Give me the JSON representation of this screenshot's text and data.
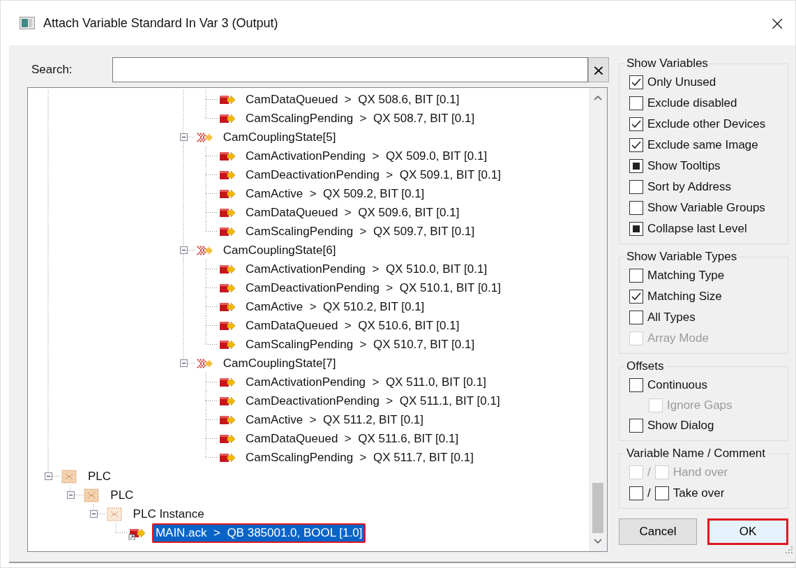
{
  "window": {
    "title": "Attach Variable Standard In Var 3 (Output)",
    "close": "×"
  },
  "search": {
    "label": "Search:",
    "clear": "×"
  },
  "tree": [
    {
      "kind": "offscreen",
      "children": [
        {
          "kind": "offscreen",
          "children": [
            {
              "kind": "offscreen",
              "children": [
                {
                  "kind": "offscreen",
                  "children": [
                    {
                      "kind": "offscreen",
                      "children": [
                        {
                          "kind": "offscreen",
                          "children": [
                            {
                              "kind": "offscreen",
                              "children": [
                                {
                                  "kind": "output",
                                  "label": "CamDataQueued  >  QX 508.6, BIT [0.1]",
                                  "selected": false,
                                  "outlined": false
                                },
                                {
                                  "kind": "output",
                                  "label": "CamScalingPending  >  QX 508.7, BIT [0.1]",
                                  "selected": false,
                                  "outlined": false
                                }
                              ]
                            },
                            {
                              "kind": "struct",
                              "label": "CamCouplingState[5]",
                              "expanded": true,
                              "children": [
                                {
                                  "kind": "output",
                                  "label": "CamActivationPending  >  QX 509.0, BIT [0.1]",
                                  "selected": false,
                                  "outlined": false
                                },
                                {
                                  "kind": "output",
                                  "label": "CamDeactivationPending  >  QX 509.1, BIT [0.1]",
                                  "selected": false,
                                  "outlined": false
                                },
                                {
                                  "kind": "output",
                                  "label": "CamActive  >  QX 509.2, BIT [0.1]",
                                  "selected": false,
                                  "outlined": false
                                },
                                {
                                  "kind": "output",
                                  "label": "CamDataQueued  >  QX 509.6, BIT [0.1]",
                                  "selected": false,
                                  "outlined": false
                                },
                                {
                                  "kind": "output",
                                  "label": "CamScalingPending  >  QX 509.7, BIT [0.1]",
                                  "selected": false,
                                  "outlined": false
                                }
                              ]
                            },
                            {
                              "kind": "struct",
                              "label": "CamCouplingState[6]",
                              "expanded": true,
                              "children": [
                                {
                                  "kind": "output",
                                  "label": "CamActivationPending  >  QX 510.0, BIT [0.1]",
                                  "selected": false,
                                  "outlined": false
                                },
                                {
                                  "kind": "output",
                                  "label": "CamDeactivationPending  >  QX 510.1, BIT [0.1]",
                                  "selected": false,
                                  "outlined": false
                                },
                                {
                                  "kind": "output",
                                  "label": "CamActive  >  QX 510.2, BIT [0.1]",
                                  "selected": false,
                                  "outlined": false
                                },
                                {
                                  "kind": "output",
                                  "label": "CamDataQueued  >  QX 510.6, BIT [0.1]",
                                  "selected": false,
                                  "outlined": false
                                },
                                {
                                  "kind": "output",
                                  "label": "CamScalingPending  >  QX 510.7, BIT [0.1]",
                                  "selected": false,
                                  "outlined": false
                                }
                              ]
                            },
                            {
                              "kind": "struct",
                              "label": "CamCouplingState[7]",
                              "expanded": true,
                              "children": [
                                {
                                  "kind": "output",
                                  "label": "CamActivationPending  >  QX 511.0, BIT [0.1]",
                                  "selected": false,
                                  "outlined": false
                                },
                                {
                                  "kind": "output",
                                  "label": "CamDeactivationPending  >  QX 511.1, BIT [0.1]",
                                  "selected": false,
                                  "outlined": false
                                },
                                {
                                  "kind": "output",
                                  "label": "CamActive  >  QX 511.2, BIT [0.1]",
                                  "selected": false,
                                  "outlined": false
                                },
                                {
                                  "kind": "output",
                                  "label": "CamDataQueued  >  QX 511.6, BIT [0.1]",
                                  "selected": false,
                                  "outlined": false
                                },
                                {
                                  "kind": "output",
                                  "label": "CamScalingPending  >  QX 511.7, BIT [0.1]",
                                  "selected": false,
                                  "outlined": false
                                }
                              ]
                            }
                          ]
                        }
                      ]
                    }
                  ]
                }
              ]
            }
          ]
        }
      ]
    },
    {
      "kind": "plc",
      "label": "PLC",
      "expanded": true,
      "children": [
        {
          "kind": "plc",
          "label": "PLC",
          "expanded": true,
          "children": [
            {
              "kind": "instance",
              "label": "PLC Instance",
              "expanded": true,
              "children": [
                {
                  "kind": "linked-output",
                  "label": "MAIN.ack  >  QB 385001.0, BOOL [1.0]",
                  "selected": true,
                  "outlined": true
                }
              ]
            }
          ]
        }
      ]
    }
  ],
  "groups": [
    {
      "title": "Show Variables",
      "options": [
        {
          "kind": "check",
          "label": "Only Unused",
          "checked": true,
          "indeterminate": false,
          "disabled": false
        },
        {
          "kind": "check",
          "label": "Exclude disabled",
          "checked": false,
          "indeterminate": false,
          "disabled": false
        },
        {
          "kind": "check",
          "label": "Exclude other Devices",
          "checked": true,
          "indeterminate": false,
          "disabled": false
        },
        {
          "kind": "check",
          "label": "Exclude same Image",
          "checked": true,
          "indeterminate": false,
          "disabled": false
        },
        {
          "kind": "check",
          "label": "Show Tooltips",
          "checked": false,
          "indeterminate": true,
          "disabled": false
        },
        {
          "kind": "check",
          "label": "Sort by Address",
          "checked": false,
          "indeterminate": false,
          "disabled": false
        },
        {
          "kind": "check",
          "label": "Show Variable Groups",
          "checked": false,
          "indeterminate": false,
          "disabled": false
        },
        {
          "kind": "check",
          "label": "Collapse last Level",
          "checked": false,
          "indeterminate": true,
          "disabled": false
        }
      ]
    },
    {
      "title": "Show Variable Types",
      "options": [
        {
          "kind": "check",
          "label": "Matching Type",
          "checked": false,
          "indeterminate": false,
          "disabled": false
        },
        {
          "kind": "check",
          "label": "Matching Size",
          "checked": true,
          "indeterminate": false,
          "disabled": false
        },
        {
          "kind": "check",
          "label": "All Types",
          "checked": false,
          "indeterminate": false,
          "disabled": false
        },
        {
          "kind": "check",
          "label": "Array Mode",
          "checked": false,
          "indeterminate": false,
          "disabled": true
        }
      ]
    },
    {
      "title": "Offsets",
      "options": [
        {
          "kind": "check",
          "label": "Continuous",
          "checked": false,
          "indeterminate": false,
          "disabled": false,
          "children": [
            {
              "kind": "check",
              "label": "Ignore Gaps",
              "checked": false,
              "indeterminate": false,
              "disabled": true
            }
          ]
        },
        {
          "kind": "check",
          "label": "Show Dialog",
          "checked": false,
          "indeterminate": false,
          "disabled": false
        }
      ]
    },
    {
      "title": "Variable Name / Comment",
      "options": [
        {
          "kind": "pair",
          "first_checked": false,
          "separator": "/",
          "label": "Hand over",
          "checked": false,
          "disabled": true
        },
        {
          "kind": "pair",
          "first_checked": false,
          "separator": "/",
          "label": "Take over",
          "checked": false,
          "disabled": false
        }
      ]
    }
  ],
  "buttons": [
    {
      "label": "Cancel",
      "outlined": false
    },
    {
      "label": "OK",
      "outlined": true
    }
  ]
}
